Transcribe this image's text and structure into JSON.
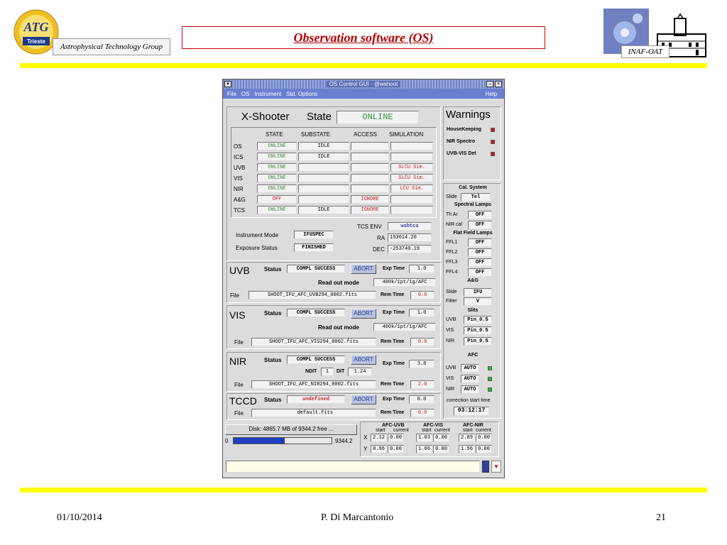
{
  "slide": {
    "title": "Observation software (OS)",
    "group": "Astrophysical Technology Group",
    "logo_text": "ATG",
    "logo_subtext": "Trieste",
    "inaf": "INAF-OAT",
    "date": "01/10/2014",
    "author": "P. Di Marcantonio",
    "page": "21"
  },
  "window": {
    "title": "OS Control GUI - @wshoot",
    "menu": [
      "File",
      "OS",
      "Instrument",
      "Std. Options"
    ],
    "help": "Help"
  },
  "state_panel": {
    "instrument": "X-Shooter",
    "state_label": "State",
    "state_value": "ONLINE",
    "headers": [
      "STATE",
      "SUBSTATE",
      "ACCESS",
      "SIMULATION"
    ],
    "rows": [
      {
        "name": "OS",
        "state": "ONLINE",
        "substate": "IDLE",
        "access": "",
        "simulation": ""
      },
      {
        "name": "ICS",
        "state": "ONLINE",
        "substate": "IDLE",
        "access": "",
        "simulation": ""
      },
      {
        "name": "UVB",
        "state": "ONLINE",
        "substate": "",
        "access": "",
        "simulation": "SLCU Sim."
      },
      {
        "name": "VIS",
        "state": "ONLINE",
        "substate": "",
        "access": "",
        "simulation": "SLCU Sim."
      },
      {
        "name": "NIR",
        "state": "ONLINE",
        "substate": "",
        "access": "",
        "simulation": "LCU Sim."
      },
      {
        "name": "A&G",
        "state": "OFF",
        "substate": "",
        "access": "IGNORE",
        "simulation": ""
      },
      {
        "name": "TCS",
        "state": "ONLINE",
        "substate": "IDLE",
        "access": "IGNORE",
        "simulation": ""
      }
    ],
    "tcs_env_label": "TCS ENV",
    "tcs_env_value": "wshtcs",
    "ra_label": "RA",
    "ra_value": "153614.20",
    "dec_label": "DEC",
    "dec_value": "-253740.19",
    "instrument_mode_label": "Instrument Mode",
    "instrument_mode_value": "IFUSPEC",
    "exposure_status_label": "Exposure Status",
    "exposure_status_value": "FINISHED"
  },
  "arms": {
    "status_label": "Status",
    "abort_label": "ABORT",
    "exp_time_label": "Exp Time",
    "file_label": "File",
    "rem_time_label": "Rem Time",
    "readout_label": "Read out mode",
    "uvb": {
      "name": "UVB",
      "status": "COMPL SUCCESS",
      "exp_time": "1.0",
      "readout": "400k/1pt/1g/AFC",
      "file": "SHOOT_IFU_AFC_UVB294_0002.fits",
      "rem_time": "0.0"
    },
    "vis": {
      "name": "VIS",
      "status": "COMPL SUCCESS",
      "exp_time": "1.0",
      "readout": "400k/1pt/1g/AFC",
      "file": "SHOOT_IFU_AFC_VIS294_0002.fits",
      "rem_time": "0.0"
    },
    "nir": {
      "name": "NIR",
      "status": "COMPL SUCCESS",
      "exp_time": "3.8",
      "ndit_label": "NDIT",
      "ndit": "1",
      "dit_label": "DIT",
      "dit": "1.24",
      "file": "SHOOT_IFU_AFC_NIR294_0002.fits",
      "rem_time": "2.0"
    },
    "tccd": {
      "name": "TCCD",
      "status": "undefined",
      "exp_time": "0.0",
      "file": "default.fits",
      "rem_time": "0.0"
    }
  },
  "disk": {
    "label": "Disk: 4865.7 MB of 9344.2 free ...",
    "min": "0",
    "max": "9344.2",
    "fraction": 0.52
  },
  "afc_table": {
    "groups": [
      "AFC-UVB",
      "AFC-VIS",
      "AFC-NIR"
    ],
    "sub_headers": [
      "start",
      "current"
    ],
    "x_label": "X",
    "y_label": "Y",
    "x": [
      "2.12",
      "0.00",
      "1.03",
      "0.00",
      "2.89",
      "0.00"
    ],
    "y": [
      "0.96",
      "0.00",
      "1.66",
      "0.00",
      "1.56",
      "0.00"
    ]
  },
  "warnings": {
    "title": "Warnings",
    "items": [
      "HouseKeeping",
      "NIR Spectro",
      "UVB-VIS Det"
    ]
  },
  "cal_system": {
    "title": "Cal. System",
    "slide_label": "Slide",
    "slide_value": "Tel",
    "spectral_title": "Spectral Lamps",
    "spectral": [
      {
        "label": "Th Ar",
        "value": "OFF"
      },
      {
        "label": "NIR cal",
        "value": "OFF"
      }
    ],
    "flat_title": "Flat Field Lamps",
    "flat": [
      {
        "label": "FFL1",
        "value": "OFF"
      },
      {
        "label": "FFL2",
        "value": "OFF"
      },
      {
        "label": "FFL3",
        "value": "OFF"
      },
      {
        "label": "FFL4",
        "value": "OFF"
      }
    ]
  },
  "ag": {
    "title": "A&G",
    "slide_label": "Slide",
    "slide_value": "IFU",
    "filter_label": "Filter",
    "filter_value": "V"
  },
  "slits": {
    "title": "Slits",
    "items": [
      {
        "label": "UVB",
        "value": "Pin_0.5"
      },
      {
        "label": "VIS",
        "value": "Pin_0.5"
      },
      {
        "label": "NIR",
        "value": "Pin_0.5"
      }
    ]
  },
  "afc": {
    "title": "AFC",
    "items": [
      {
        "label": "UVB",
        "value": "AUTO"
      },
      {
        "label": "VIS",
        "value": "AUTO"
      },
      {
        "label": "NIR",
        "value": "AUTO"
      }
    ],
    "correction_label": "correction start time",
    "correction_time": "03:12:17"
  },
  "colors": {
    "menubar": "#6b7fd0",
    "online": "#3a8a3a",
    "alert": "#c02020",
    "slide_accent": "#ffff00"
  }
}
